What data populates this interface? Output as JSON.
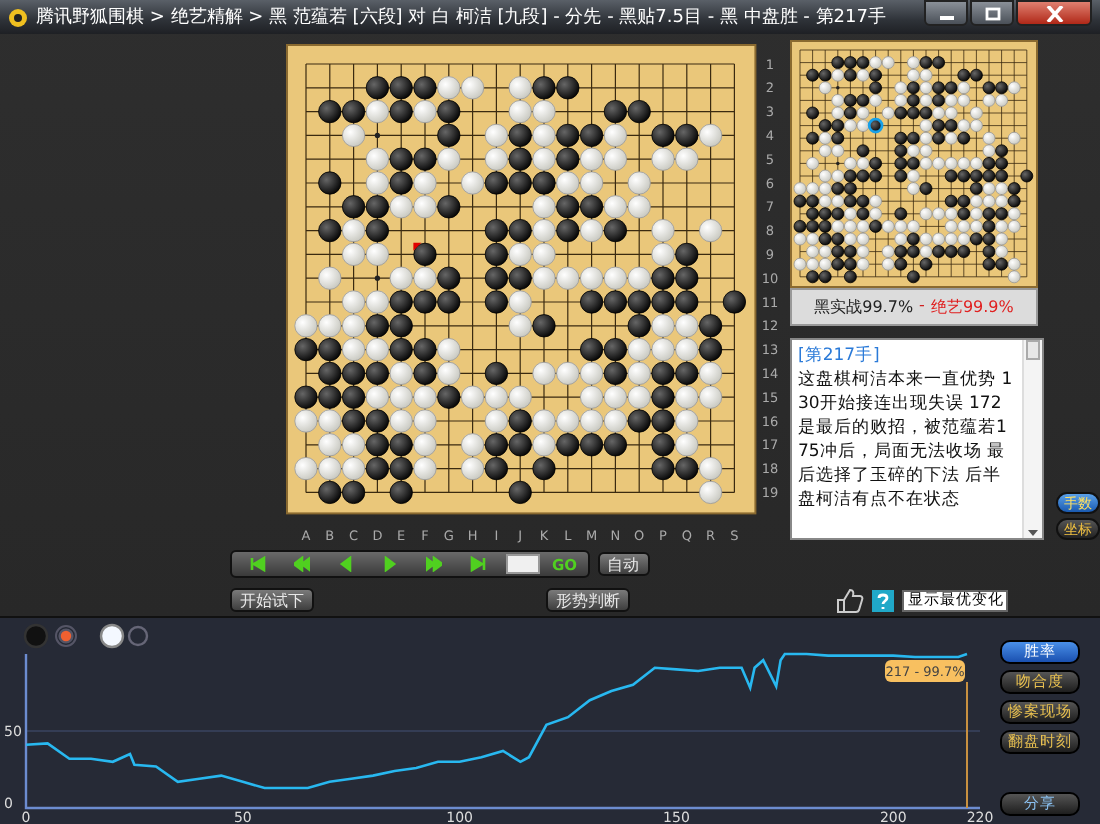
{
  "window": {
    "title": "腾讯野狐围棋 > 绝艺精解 > 黑 范蕴若 [六段] 对 白 柯洁 [九段] - 分先 - 黑贴7.5目 - 黑 中盘胜 - 第217手"
  },
  "board": {
    "columns": [
      "A",
      "B",
      "C",
      "D",
      "E",
      "F",
      "G",
      "H",
      "I",
      "J",
      "K",
      "L",
      "M",
      "N",
      "O",
      "P",
      "Q",
      "R",
      "S"
    ],
    "row_labels": [
      "1",
      "2",
      "3",
      "4",
      "5",
      "6",
      "7",
      "8",
      "9",
      "10",
      "11",
      "12",
      "13",
      "14",
      "15",
      "16",
      "17",
      "18",
      "19"
    ]
  },
  "mini_board": {
    "actual": "黑实战99.7%",
    "separator": "-",
    "ai": "绝艺99.9%"
  },
  "commentary": {
    "move_label": "[第217手]",
    "text": "这盘棋柯洁本来一直优势 130开始接连出现失误 172是最后的败招，被范蕴若175冲后，局面无法收场 最后选择了玉碎的下法 后半盘柯洁有点不在状态"
  },
  "side_toggles": [
    {
      "label": "手数",
      "selected": true
    },
    {
      "label": "坐标",
      "selected": false
    }
  ],
  "playback": {
    "buttons": [
      {
        "kind": "first"
      },
      {
        "kind": "back-many"
      },
      {
        "kind": "back"
      },
      {
        "kind": "forward"
      },
      {
        "kind": "forward-many"
      },
      {
        "kind": "last"
      }
    ],
    "go": "GO",
    "auto": "自动"
  },
  "try_button": "开始试下",
  "judge_button": "形势判断",
  "variation_select": {
    "value": "显示最优变化"
  },
  "chart": {
    "tabs": [
      {
        "label": "胜率",
        "selected": true
      },
      {
        "label": "吻合度",
        "selected": false
      },
      {
        "label": "惨案现场",
        "selected": false
      },
      {
        "label": "翻盘时刻",
        "selected": false
      }
    ],
    "share_button": "分享",
    "chart_data": {
      "type": "line",
      "xlim": [
        0,
        220
      ],
      "ylim": [
        0,
        100
      ],
      "xticks": [
        0,
        50,
        100,
        150,
        200,
        220
      ],
      "yticks": [
        0,
        50
      ],
      "x": [
        0,
        5,
        10,
        15,
        20,
        24,
        25,
        30,
        35,
        40,
        45,
        50,
        55,
        60,
        65,
        70,
        75,
        80,
        85,
        90,
        95,
        100,
        105,
        110,
        114,
        116,
        120,
        125,
        130,
        135,
        140,
        145,
        150,
        155,
        160,
        165,
        167,
        168,
        170,
        173,
        174,
        175,
        180,
        185,
        190,
        195,
        200,
        205,
        210,
        215,
        217
      ],
      "values": [
        41,
        42,
        32,
        32,
        30,
        35,
        28,
        27,
        17,
        19,
        21,
        17,
        13,
        13,
        13,
        17,
        19,
        21,
        24,
        26,
        30,
        30,
        33,
        37,
        30,
        33,
        54,
        59,
        70,
        76,
        80,
        91,
        90,
        89,
        91,
        91,
        78,
        91,
        96,
        79,
        96,
        100,
        100,
        99,
        99,
        99,
        99,
        98,
        98,
        98,
        100
      ],
      "ref_lines": [
        {
          "axis": "x",
          "value": 217
        }
      ],
      "annotations": [
        {
          "x": 217,
          "y": 100,
          "text": "217 - 99.7%"
        }
      ]
    }
  }
}
